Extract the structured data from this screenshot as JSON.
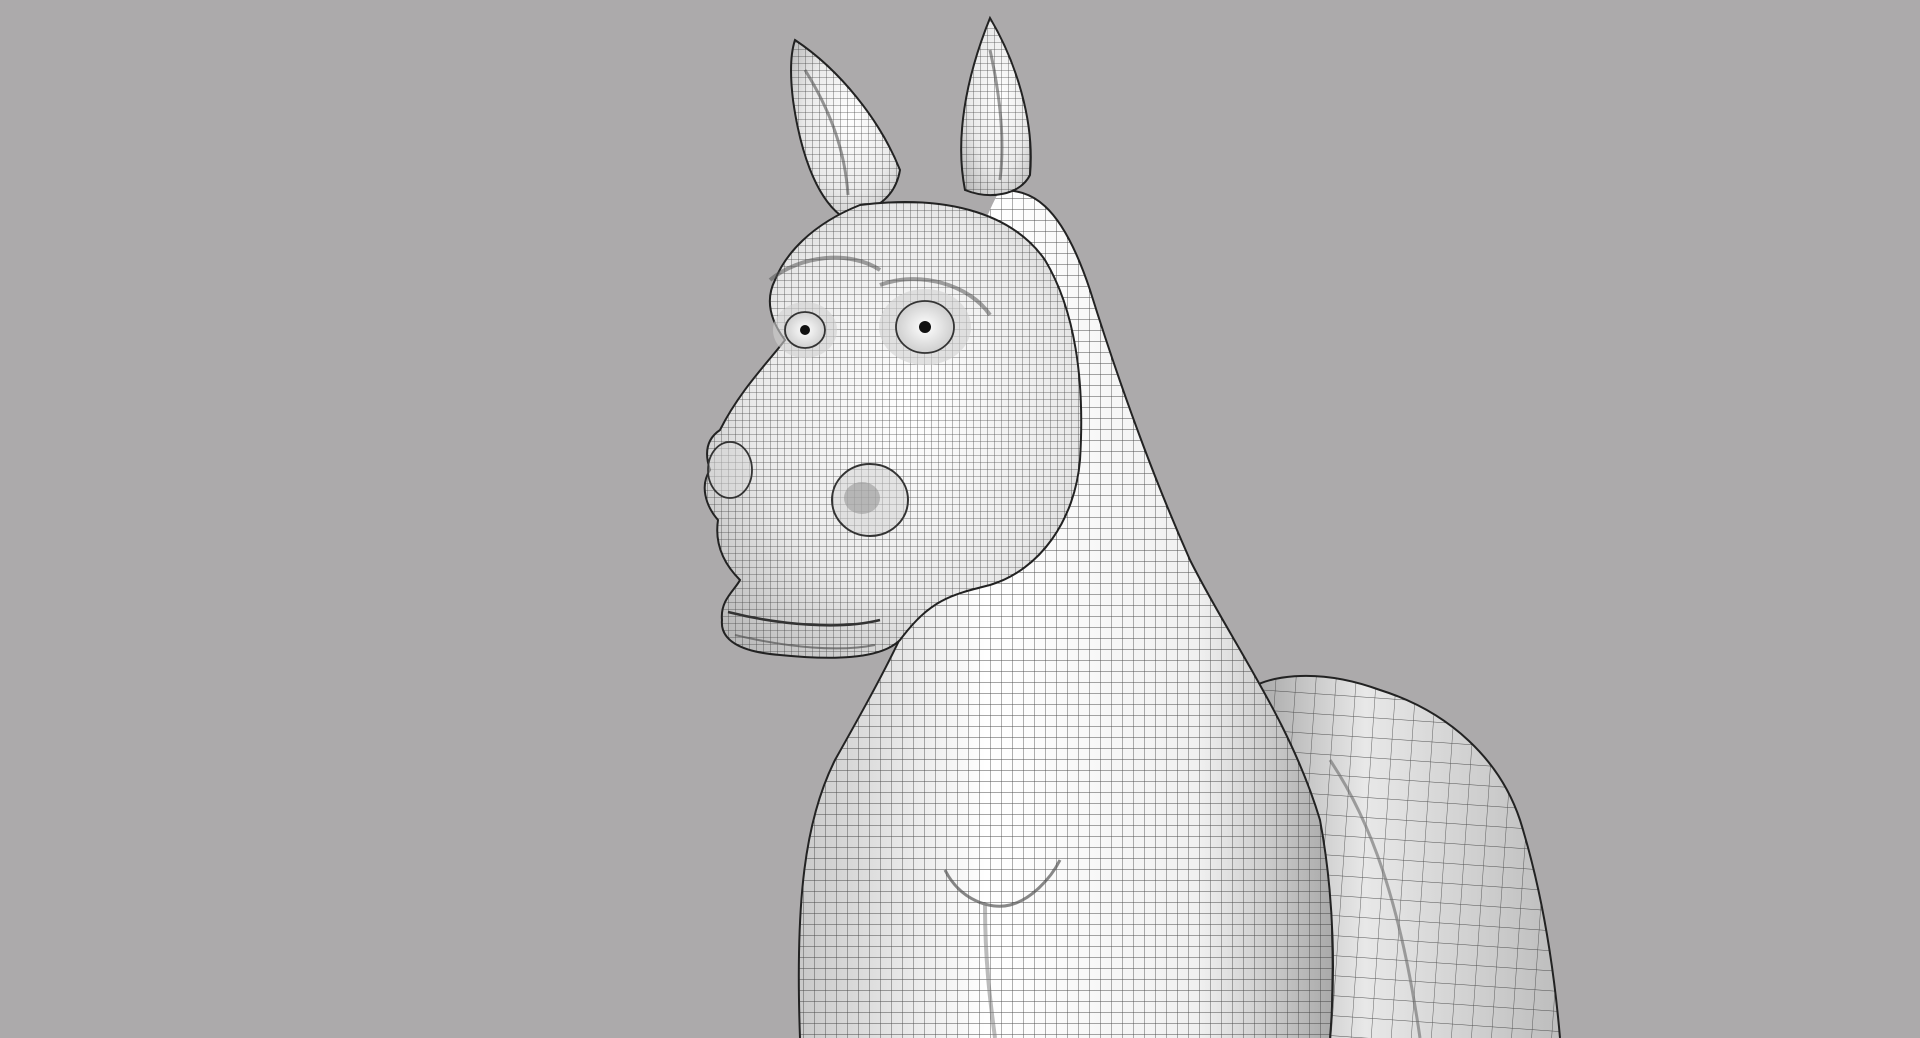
{
  "scene": {
    "subject": "horse-wireframe-model",
    "background_color": "#acaaab",
    "mesh_fill_color": "#f2f2f2",
    "mesh_shade_color": "#bdbdbd",
    "wire_color": "#3a3a3a",
    "outline_color": "#222222"
  }
}
